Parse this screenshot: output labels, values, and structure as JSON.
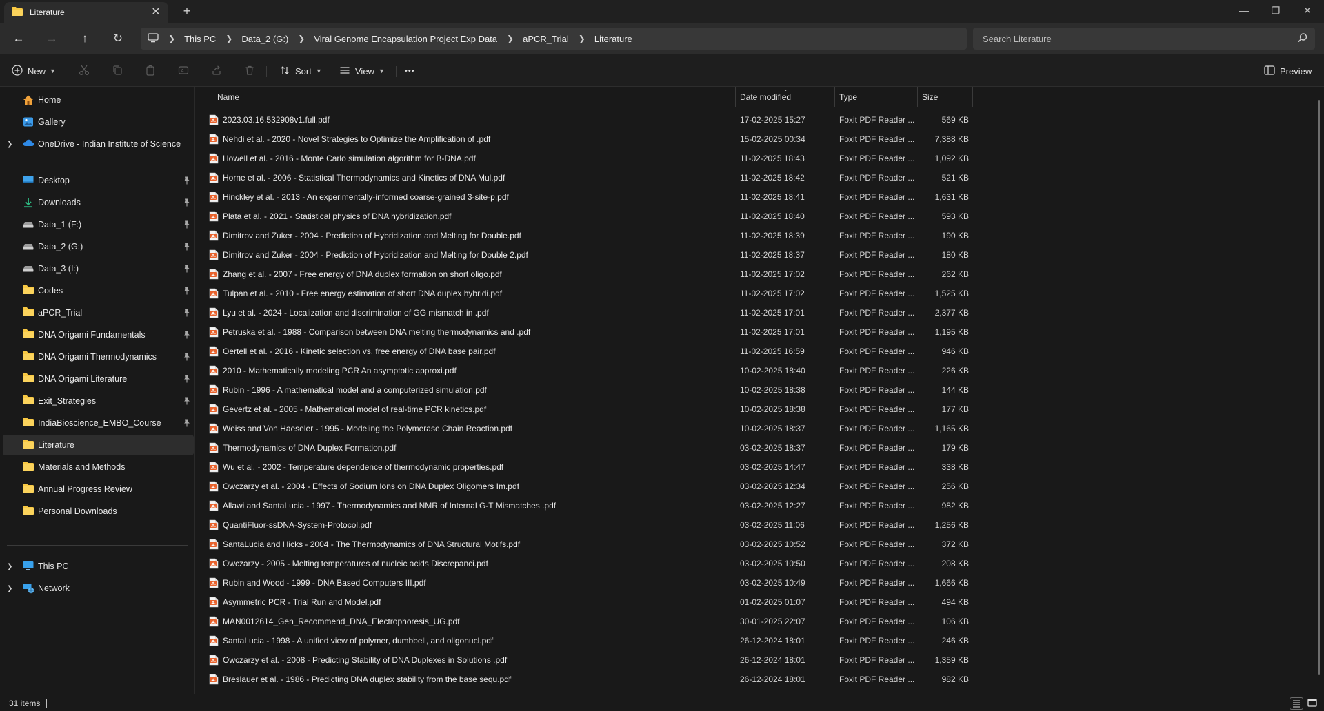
{
  "window": {
    "tab_title": "Literature",
    "tab_close": "✕",
    "new_tab": "+",
    "minimize": "—",
    "maximize": "❐",
    "close": "✕"
  },
  "nav": {
    "back": "←",
    "forward": "→",
    "up": "↑",
    "refresh": "↻",
    "breadcrumbs": [
      "This PC",
      "Data_2 (G:)",
      "Viral Genome Encapsulation Project Exp Data",
      "aPCR_Trial",
      "Literature"
    ],
    "search_placeholder": "Search Literature"
  },
  "toolbar": {
    "new_label": "New",
    "sort_label": "Sort",
    "view_label": "View",
    "more_label": "•••",
    "preview_label": "Preview"
  },
  "sidebar": {
    "top": [
      {
        "label": "Home",
        "icon": "home-icon"
      },
      {
        "label": "Gallery",
        "icon": "gallery-icon"
      },
      {
        "label": "OneDrive - Indian Institute of Science",
        "icon": "cloud-icon"
      }
    ],
    "quick_access": [
      {
        "label": "Desktop",
        "icon": "desktop-icon"
      },
      {
        "label": "Downloads",
        "icon": "download-icon"
      },
      {
        "label": "Data_1 (F:)",
        "icon": "drive-icon"
      },
      {
        "label": "Data_2 (G:)",
        "icon": "drive-icon"
      },
      {
        "label": "Data_3 (I:)",
        "icon": "drive-icon"
      },
      {
        "label": "Codes",
        "icon": "folder-icon"
      },
      {
        "label": "aPCR_Trial",
        "icon": "folder-icon"
      },
      {
        "label": "DNA Origami Fundamentals",
        "icon": "folder-icon"
      },
      {
        "label": "DNA Origami Thermodynamics",
        "icon": "folder-icon"
      },
      {
        "label": "DNA Origami Literature",
        "icon": "folder-icon"
      },
      {
        "label": "Exit_Strategies",
        "icon": "folder-icon"
      },
      {
        "label": "IndiaBioscience_EMBO_Course",
        "icon": "folder-icon"
      },
      {
        "label": "Literature",
        "icon": "folder-icon"
      },
      {
        "label": "Materials and Methods",
        "icon": "folder-icon"
      },
      {
        "label": "Annual Progress Review",
        "icon": "folder-icon"
      },
      {
        "label": "Personal Downloads",
        "icon": "folder-icon"
      }
    ],
    "bottom": [
      {
        "label": "This PC",
        "icon": "computer-icon"
      },
      {
        "label": "Network",
        "icon": "network-icon"
      }
    ]
  },
  "columns": {
    "name": "Name",
    "date": "Date modified",
    "type": "Type",
    "size": "Size"
  },
  "files": [
    {
      "name": "2023.03.16.532908v1.full.pdf",
      "date": "17-02-2025 15:27",
      "type": "Foxit PDF Reader ...",
      "size": "569 KB"
    },
    {
      "name": "Nehdi et al. - 2020 - Novel Strategies to Optimize the Amplification of .pdf",
      "date": "15-02-2025 00:34",
      "type": "Foxit PDF Reader ...",
      "size": "7,388 KB"
    },
    {
      "name": "Howell et al. - 2016 - Monte Carlo simulation algorithm for B-DNA.pdf",
      "date": "11-02-2025 18:43",
      "type": "Foxit PDF Reader ...",
      "size": "1,092 KB"
    },
    {
      "name": "Horne et al. - 2006 - Statistical Thermodynamics and Kinetics of DNA Mul.pdf",
      "date": "11-02-2025 18:42",
      "type": "Foxit PDF Reader ...",
      "size": "521 KB"
    },
    {
      "name": "Hinckley et al. - 2013 - An experimentally-informed coarse-grained 3-site-p.pdf",
      "date": "11-02-2025 18:41",
      "type": "Foxit PDF Reader ...",
      "size": "1,631 KB"
    },
    {
      "name": "Plata et al. - 2021 - Statistical physics of DNA hybridization.pdf",
      "date": "11-02-2025 18:40",
      "type": "Foxit PDF Reader ...",
      "size": "593 KB"
    },
    {
      "name": "Dimitrov and Zuker - 2004 - Prediction of Hybridization and Melting for Double.pdf",
      "date": "11-02-2025 18:39",
      "type": "Foxit PDF Reader ...",
      "size": "190 KB"
    },
    {
      "name": "Dimitrov and Zuker - 2004 - Prediction of Hybridization and Melting for Double 2.pdf",
      "date": "11-02-2025 18:37",
      "type": "Foxit PDF Reader ...",
      "size": "180 KB"
    },
    {
      "name": "Zhang et al. - 2007 - Free energy of DNA duplex formation on short oligo.pdf",
      "date": "11-02-2025 17:02",
      "type": "Foxit PDF Reader ...",
      "size": "262 KB"
    },
    {
      "name": "Tulpan et al. - 2010 - Free energy estimation of short DNA duplex hybridi.pdf",
      "date": "11-02-2025 17:02",
      "type": "Foxit PDF Reader ...",
      "size": "1,525 KB"
    },
    {
      "name": "Lyu et al. - 2024 - Localization and discrimination of GG mismatch in .pdf",
      "date": "11-02-2025 17:01",
      "type": "Foxit PDF Reader ...",
      "size": "2,377 KB"
    },
    {
      "name": "Petruska et al. - 1988 - Comparison between DNA melting thermodynamics and .pdf",
      "date": "11-02-2025 17:01",
      "type": "Foxit PDF Reader ...",
      "size": "1,195 KB"
    },
    {
      "name": "Oertell et al. - 2016 - Kinetic selection vs. free energy of DNA base pair.pdf",
      "date": "11-02-2025 16:59",
      "type": "Foxit PDF Reader ...",
      "size": "946 KB"
    },
    {
      "name": "2010 - Mathematically modeling PCR An asymptotic approxi.pdf",
      "date": "10-02-2025 18:40",
      "type": "Foxit PDF Reader ...",
      "size": "226 KB"
    },
    {
      "name": "Rubin - 1996 - A mathematical model and a computerized simulation.pdf",
      "date": "10-02-2025 18:38",
      "type": "Foxit PDF Reader ...",
      "size": "144 KB"
    },
    {
      "name": "Gevertz et al. - 2005 - Mathematical model of real-time PCR kinetics.pdf",
      "date": "10-02-2025 18:38",
      "type": "Foxit PDF Reader ...",
      "size": "177 KB"
    },
    {
      "name": "Weiss and Von Haeseler - 1995 - Modeling the Polymerase Chain Reaction.pdf",
      "date": "10-02-2025 18:37",
      "type": "Foxit PDF Reader ...",
      "size": "1,165 KB"
    },
    {
      "name": "Thermodynamics of DNA Duplex Formation.pdf",
      "date": "03-02-2025 18:37",
      "type": "Foxit PDF Reader ...",
      "size": "179 KB"
    },
    {
      "name": "Wu et al. - 2002 - Temperature dependence of thermodynamic properties.pdf",
      "date": "03-02-2025 14:47",
      "type": "Foxit PDF Reader ...",
      "size": "338 KB"
    },
    {
      "name": "Owczarzy et al. - 2004 - Effects of Sodium Ions on DNA Duplex Oligomers Im.pdf",
      "date": "03-02-2025 12:34",
      "type": "Foxit PDF Reader ...",
      "size": "256 KB"
    },
    {
      "name": "Allawi and SantaLucia - 1997 - Thermodynamics and NMR of Internal G-T Mismatches .pdf",
      "date": "03-02-2025 12:27",
      "type": "Foxit PDF Reader ...",
      "size": "982 KB"
    },
    {
      "name": "QuantiFluor-ssDNA-System-Protocol.pdf",
      "date": "03-02-2025 11:06",
      "type": "Foxit PDF Reader ...",
      "size": "1,256 KB"
    },
    {
      "name": "SantaLucia and Hicks - 2004 - The Thermodynamics of DNA Structural Motifs.pdf",
      "date": "03-02-2025 10:52",
      "type": "Foxit PDF Reader ...",
      "size": "372 KB"
    },
    {
      "name": "Owczarzy - 2005 - Melting temperatures of nucleic acids Discrepanci.pdf",
      "date": "03-02-2025 10:50",
      "type": "Foxit PDF Reader ...",
      "size": "208 KB"
    },
    {
      "name": "Rubin and Wood - 1999 - DNA Based Computers III.pdf",
      "date": "03-02-2025 10:49",
      "type": "Foxit PDF Reader ...",
      "size": "1,666 KB"
    },
    {
      "name": "Asymmetric PCR - Trial Run and Model.pdf",
      "date": "01-02-2025 01:07",
      "type": "Foxit PDF Reader ...",
      "size": "494 KB"
    },
    {
      "name": "MAN0012614_Gen_Recommend_DNA_Electrophoresis_UG.pdf",
      "date": "30-01-2025 22:07",
      "type": "Foxit PDF Reader ...",
      "size": "106 KB"
    },
    {
      "name": "SantaLucia - 1998 - A unified view of polymer, dumbbell, and oligonucl.pdf",
      "date": "26-12-2024 18:01",
      "type": "Foxit PDF Reader ...",
      "size": "246 KB"
    },
    {
      "name": "Owczarzy et al. - 2008 - Predicting Stability of DNA Duplexes in Solutions .pdf",
      "date": "26-12-2024 18:01",
      "type": "Foxit PDF Reader ...",
      "size": "1,359 KB"
    },
    {
      "name": "Breslauer et al. - 1986 - Predicting DNA duplex stability from the base sequ.pdf",
      "date": "26-12-2024 18:01",
      "type": "Foxit PDF Reader ...",
      "size": "982 KB"
    }
  ],
  "status": {
    "item_count": "31 items"
  },
  "colors": {
    "accent_folder": "#f8c843",
    "pdf_icon": "#e8622c"
  }
}
